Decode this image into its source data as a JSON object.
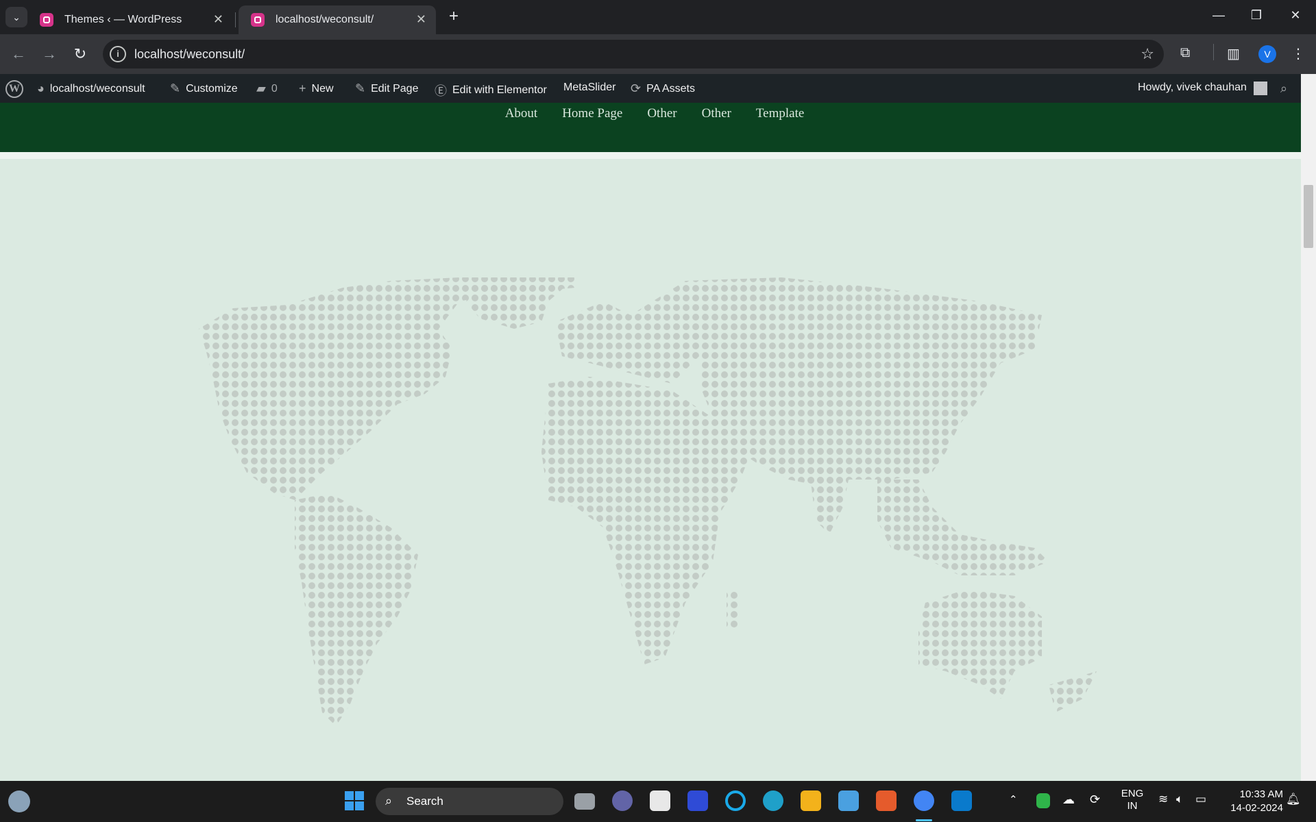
{
  "browser": {
    "tabs": [
      {
        "title": "Themes ‹ — WordPress",
        "active": false
      },
      {
        "title": "localhost/weconsult/",
        "active": true
      }
    ],
    "url": "localhost/weconsult/",
    "profile_initial": "V"
  },
  "wp_admin_bar": {
    "site": "localhost/weconsult",
    "customize": "Customize",
    "comments_count": "0",
    "new": "New",
    "edit_page": "Edit Page",
    "edit_elementor": "Edit with Elementor",
    "metaslider": "MetaSlider",
    "pa_assets": "PA Assets",
    "howdy": "Howdy, vivek chauhan"
  },
  "site_nav": [
    "About",
    "Home Page",
    "Other",
    "Other",
    "Template"
  ],
  "colors": {
    "header_green": "#0b4220",
    "content_bg": "#dbeae1",
    "map_dot": "#c3ccc6"
  },
  "content_image": "dotted-world-map",
  "taskbar": {
    "search_label": "Search",
    "lang_1": "ENG",
    "lang_2": "IN",
    "time": "10:33 AM",
    "date": "14-02-2024"
  }
}
